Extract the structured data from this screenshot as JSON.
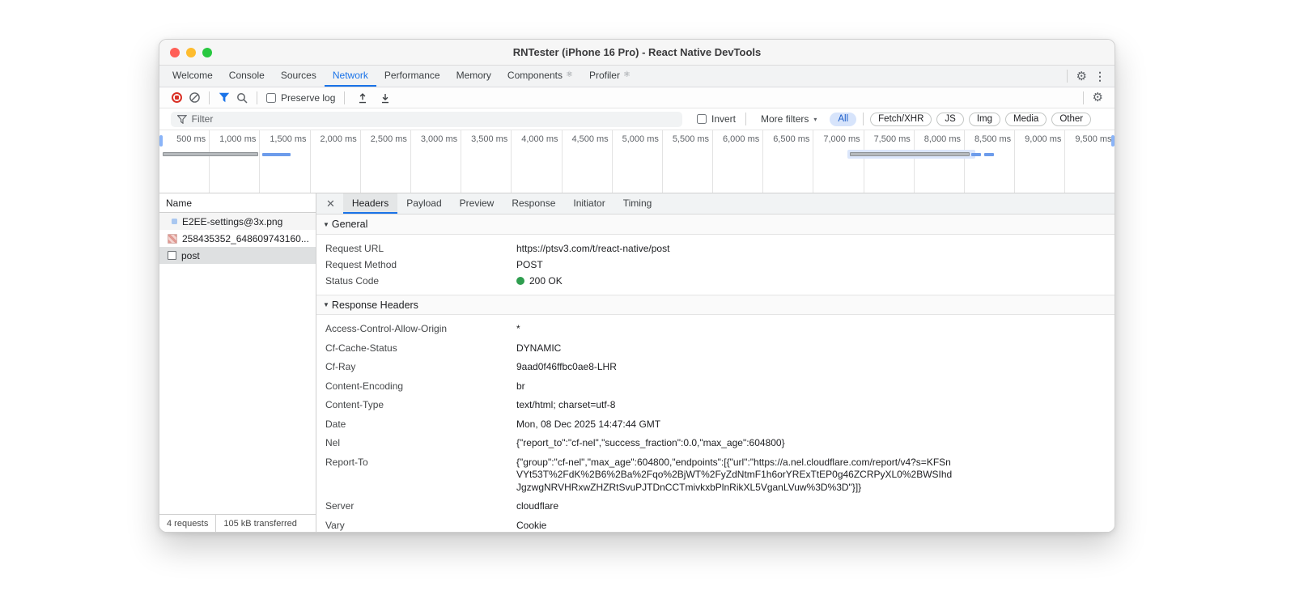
{
  "window": {
    "title": "RNTester (iPhone 16 Pro) - React Native DevTools"
  },
  "icons": {
    "react": "⚛",
    "gear": "⚙",
    "kebab": "⋮",
    "close": "✕",
    "disclosure": "▼",
    "more_arrow": "▾"
  },
  "colors": {
    "accent_blue": "#1a73e8",
    "record_red": "#d93025",
    "status_green": "#2f9e4f",
    "active_pill_bg": "#d7e4fb",
    "selected_row": "#dee0e1"
  },
  "main_tabs": [
    {
      "label": "Welcome"
    },
    {
      "label": "Console"
    },
    {
      "label": "Sources"
    },
    {
      "label": "Network",
      "active": true
    },
    {
      "label": "Performance"
    },
    {
      "label": "Memory"
    },
    {
      "label": "Components",
      "react_icon": true
    },
    {
      "label": "Profiler",
      "react_icon": true
    }
  ],
  "toolbar": {
    "preserve_log_label": "Preserve log"
  },
  "filter_bar": {
    "placeholder": "Filter",
    "invert_label": "Invert",
    "more_filters_label": "More filters",
    "pills": [
      "All",
      "Fetch/XHR",
      "JS",
      "Img",
      "Media",
      "Other"
    ],
    "active_pill": "All"
  },
  "timeline": {
    "labels": [
      "500 ms",
      "1,000 ms",
      "1,500 ms",
      "2,000 ms",
      "2,500 ms",
      "3,000 ms",
      "3,500 ms",
      "4,000 ms",
      "4,500 ms",
      "5,000 ms",
      "5,500 ms",
      "6,000 ms",
      "6,500 ms",
      "7,000 ms",
      "7,500 ms",
      "8,000 ms",
      "8,500 ms",
      "9,000 ms",
      "9,500 ms"
    ],
    "bars": [
      {
        "type": "gray",
        "from_ms": 30,
        "to_ms": 980
      },
      {
        "type": "blue",
        "from_ms": 1030,
        "to_ms": 1310
      },
      {
        "type": "gray-highlighted",
        "from_ms": 7060,
        "to_ms": 8050
      },
      {
        "type": "blue",
        "from_ms": 8070,
        "to_ms": 8160
      },
      {
        "type": "blue",
        "from_ms": 8200,
        "to_ms": 8290
      }
    ]
  },
  "request_list": {
    "header": "Name",
    "rows": [
      {
        "name": "E2EE-settings@3x.png"
      },
      {
        "name": "258435352_648609743160..."
      },
      {
        "name": "post",
        "selected": true
      }
    ]
  },
  "status_bar": {
    "requests": "4 requests",
    "transferred": "105 kB transferred"
  },
  "details": {
    "tabs": [
      "Headers",
      "Payload",
      "Preview",
      "Response",
      "Initiator",
      "Timing"
    ],
    "active_tab": "Headers",
    "general": {
      "title": "General",
      "rows": [
        {
          "name": "Request URL",
          "value": "https://ptsv3.com/t/react-native/post"
        },
        {
          "name": "Request Method",
          "value": "POST"
        },
        {
          "name": "Status Code",
          "value": "200 OK"
        }
      ]
    },
    "response_headers": {
      "title": "Response Headers",
      "rows": [
        {
          "name": "Access-Control-Allow-Origin",
          "value": "*"
        },
        {
          "name": "Cf-Cache-Status",
          "value": "DYNAMIC"
        },
        {
          "name": "Cf-Ray",
          "value": "9aad0f46ffbc0ae8-LHR"
        },
        {
          "name": "Content-Encoding",
          "value": "br"
        },
        {
          "name": "Content-Type",
          "value": "text/html; charset=utf-8"
        },
        {
          "name": "Date",
          "value": "Mon, 08 Dec 2025 14:47:44 GMT"
        },
        {
          "name": "Nel",
          "value": "{\"report_to\":\"cf-nel\",\"success_fraction\":0.0,\"max_age\":604800}"
        },
        {
          "name": "Report-To",
          "value": "{\"group\":\"cf-nel\",\"max_age\":604800,\"endpoints\":[{\"url\":\"https://a.nel.cloudflare.com/report/v4?s=KFSnVYt53T%2FdK%2B6%2Ba%2Fqo%2BjWT%2FyZdNtmF1h6orYRExTtEP0g46ZCRPyXL0%2BWSIhdJgzwgNRVHRxwZHZRtSvuPJTDnCCTmivkxbPlnRikXL5VganLVuw%3D%3D\"}]}"
        },
        {
          "name": "Server",
          "value": "cloudflare"
        },
        {
          "name": "Vary",
          "value": "Cookie"
        }
      ]
    }
  }
}
